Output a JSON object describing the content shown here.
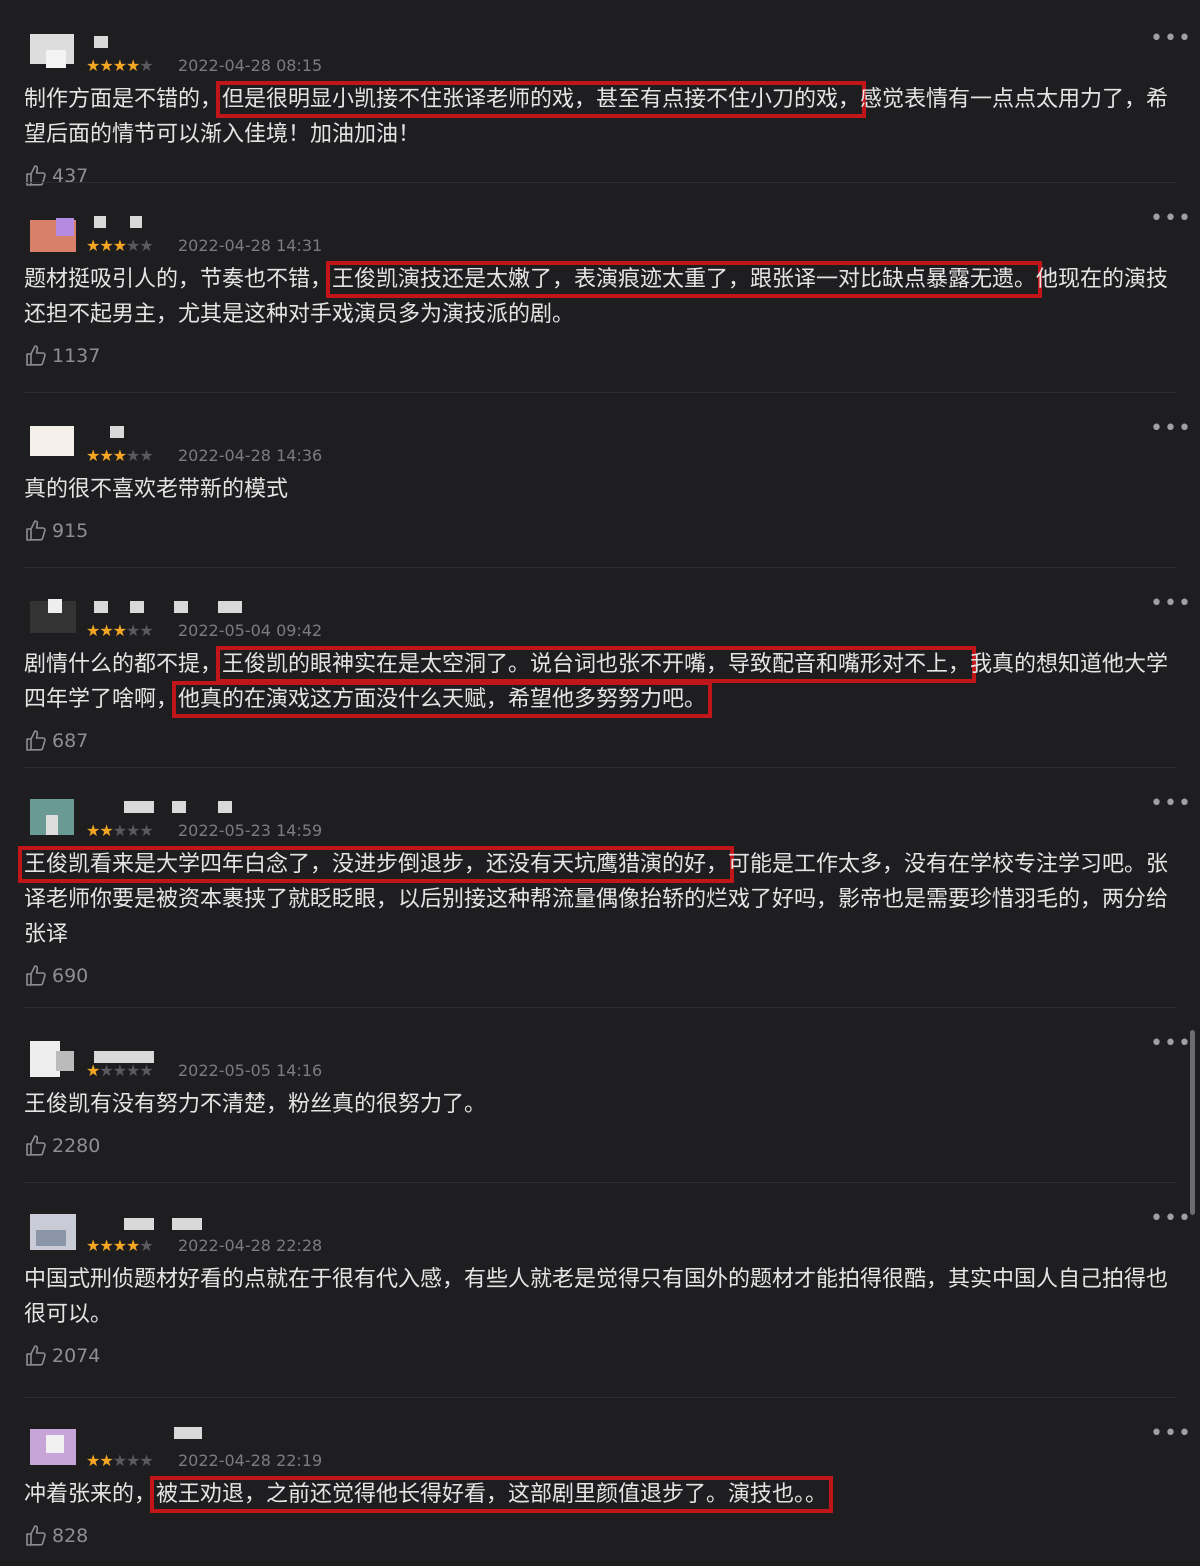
{
  "reviews": [
    {
      "stars": 4,
      "date": "2022-04-28 08:15",
      "likes": "437",
      "segments": [
        {
          "text": "制作方面是不错的，",
          "hl": false
        },
        {
          "text": "但是很明显小凯接不住张译老师的戏，甚至有点接不住小刀的戏，",
          "hl": true
        },
        {
          "text": "感觉表情有一点点太用力了，希望后面的情节可以渐入佳境！加油加油！",
          "hl": false
        }
      ]
    },
    {
      "stars": 3,
      "date": "2022-04-28 14:31",
      "likes": "1137",
      "segments": [
        {
          "text": "题材挺吸引人的，节奏也不错，",
          "hl": false
        },
        {
          "text": "王俊凯演技还是太嫩了，表演痕迹太重了，跟张译一对比缺点暴露无遗。",
          "hl": true
        },
        {
          "text": "他现在的演技还担不起男主，尤其是这种对手戏演员多为演技派的剧。",
          "hl": false
        }
      ]
    },
    {
      "stars": 3,
      "date": "2022-04-28 14:36",
      "likes": "915",
      "segments": [
        {
          "text": "真的很不喜欢老带新的模式",
          "hl": false
        }
      ]
    },
    {
      "stars": 3,
      "date": "2022-05-04 09:42",
      "likes": "687",
      "segments": [
        {
          "text": "剧情什么的都不提，",
          "hl": false
        },
        {
          "text": "王俊凯的眼神实在是太空洞了。说台词也张不开嘴，导致配音和嘴形对不上，",
          "hl": true
        },
        {
          "text": "我真的想知道他大学四年学了啥啊，",
          "hl": false
        },
        {
          "text": "他真的在演戏这方面没什么天赋，希望他多努努力吧。",
          "hl": true
        }
      ]
    },
    {
      "stars": 2,
      "date": "2022-05-23 14:59",
      "likes": "690",
      "segments": [
        {
          "text": "王俊凯看来是大学四年白念了，没进步倒退步，还没有天坑鹰猎演的好，",
          "hl": true
        },
        {
          "text": "可能是工作太多，没有在学校专注学习吧。张译老师你要是被资本裹挟了就眨眨眼，以后别接这种帮流量偶像抬轿的烂戏了好吗，影帝也是需要珍惜羽毛的，两分给张译",
          "hl": false
        }
      ]
    },
    {
      "stars": 1,
      "date": "2022-05-05 14:16",
      "likes": "2280",
      "segments": [
        {
          "text": "王俊凯有没有努力不清楚，粉丝真的很努力了。",
          "hl": false
        }
      ]
    },
    {
      "stars": 4,
      "date": "2022-04-28 22:28",
      "likes": "2074",
      "segments": [
        {
          "text": "中国式刑侦题材好看的点就在于很有代入感，有些人就老是觉得只有国外的题材才能拍得很酷，其实中国人自己拍得也很可以。",
          "hl": false
        }
      ]
    },
    {
      "stars": 2,
      "date": "2022-04-28 22:19",
      "likes": "828",
      "segments": [
        {
          "text": "冲着张来的，",
          "hl": false
        },
        {
          "text": "被王劝退，之前还觉得他长得好看，这部剧里颜值退步了。演技也。。",
          "hl": true
        }
      ]
    }
  ],
  "colors": {
    "star_on": "#f5a623",
    "star_off": "#5a5a5e",
    "highlight_box": "#c0161a"
  },
  "icons": {
    "like": "thumbs-up-icon",
    "more": "more-icon"
  }
}
